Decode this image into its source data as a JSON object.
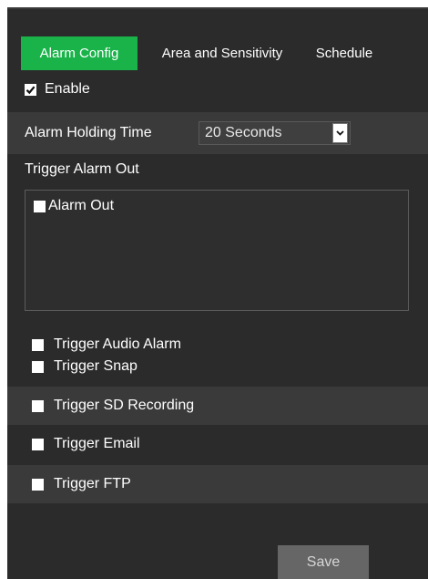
{
  "tabs": [
    {
      "label": "Alarm Config",
      "active": true
    },
    {
      "label": "Area and Sensitivity",
      "active": false
    },
    {
      "label": "Schedule",
      "active": false
    }
  ],
  "enable": {
    "label": "Enable",
    "checked": true
  },
  "holding_time": {
    "label": "Alarm Holding Time",
    "value": "20 Seconds"
  },
  "trigger_alarm_out": {
    "label": "Trigger Alarm Out",
    "items": [
      {
        "label": "Alarm Out",
        "checked": false
      }
    ]
  },
  "triggers": [
    {
      "label": "Trigger Audio Alarm",
      "checked": false
    },
    {
      "label": "Trigger Snap",
      "checked": false
    },
    {
      "label": "Trigger SD Recording",
      "checked": false
    },
    {
      "label": "Trigger Email",
      "checked": false
    },
    {
      "label": "Trigger FTP",
      "checked": false
    }
  ],
  "save_label": "Save",
  "colors": {
    "panel_bg": "#2b2b2b",
    "row_shade": "#3a3a3a",
    "tab_active": "#19b34a",
    "button_bg": "#666666"
  }
}
